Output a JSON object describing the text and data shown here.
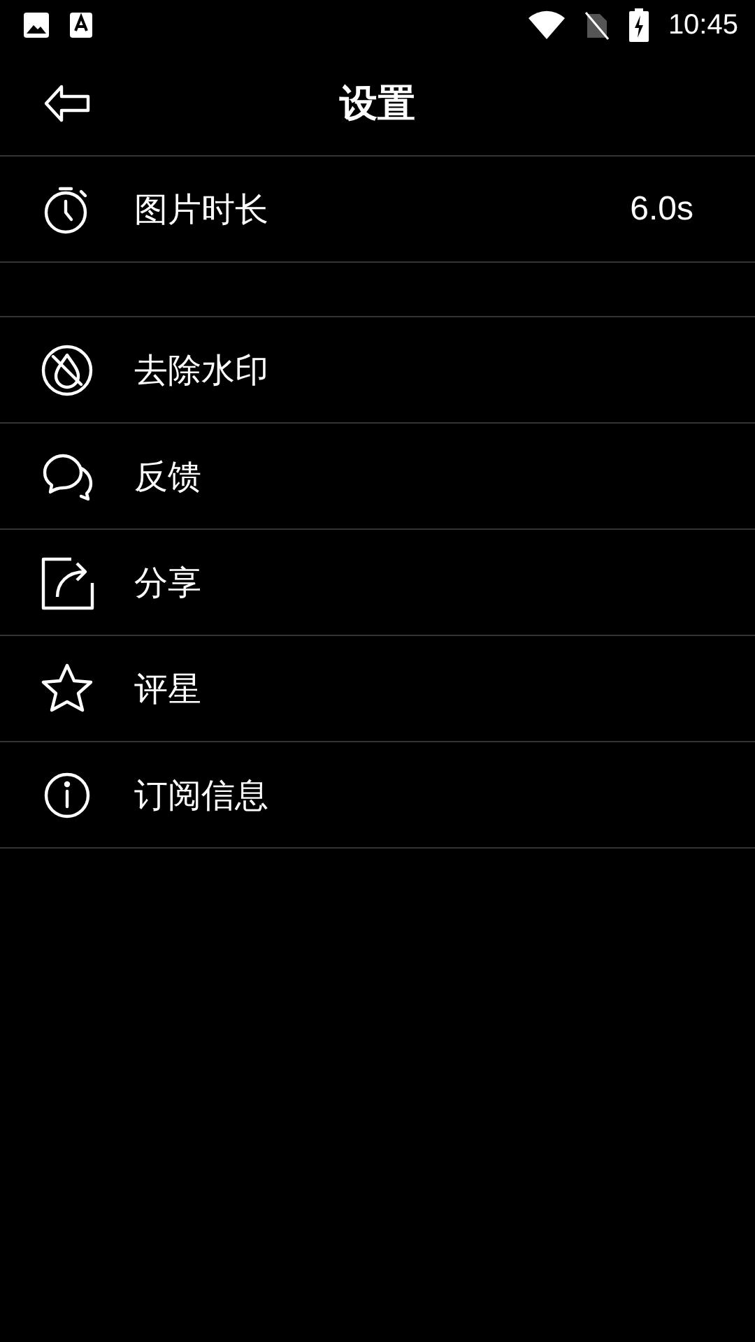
{
  "status_bar": {
    "time": "10:45"
  },
  "header": {
    "title": "设置"
  },
  "groups": [
    {
      "items": [
        {
          "label": "图片时长",
          "value": "6.0s"
        }
      ]
    },
    {
      "items": [
        {
          "label": "去除水印"
        },
        {
          "label": "反馈"
        },
        {
          "label": "分享"
        },
        {
          "label": "评星"
        },
        {
          "label": "订阅信息"
        }
      ]
    }
  ]
}
